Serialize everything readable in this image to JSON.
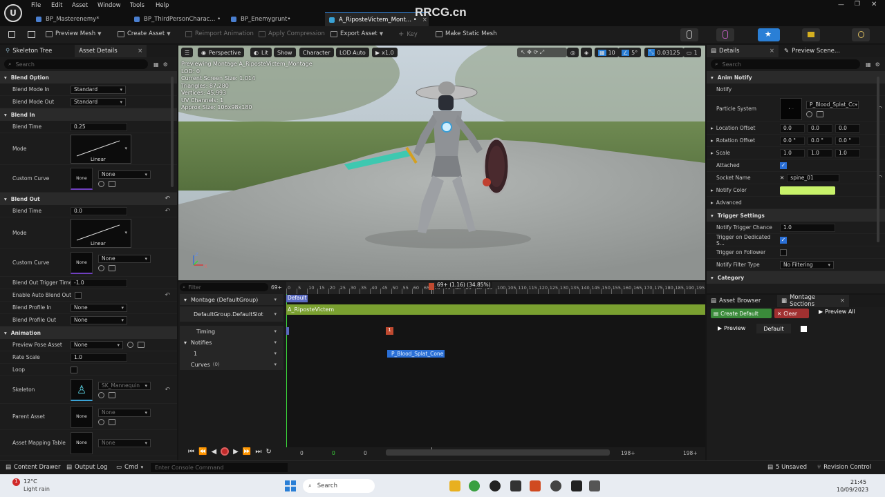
{
  "menu": [
    "File",
    "Edit",
    "Asset",
    "Window",
    "Tools",
    "Help"
  ],
  "doc_tabs": [
    {
      "label": "BP_Masterenemy*"
    },
    {
      "label": "BP_ThirdPersonCharac... •"
    },
    {
      "label": "BP_Enemygrunt•"
    },
    {
      "label": "A_RiposteVictem_Mont... •"
    }
  ],
  "watermark": "RRCG.cn",
  "toolbar": {
    "preview_mesh": "Preview Mesh",
    "create_asset": "Create Asset",
    "reimport": "Reimport Animation",
    "apply_compression": "Apply Compression",
    "export_asset": "Export Asset",
    "key": "Key",
    "make_static_mesh": "Make Static Mesh"
  },
  "left_panel": {
    "tab_skeleton": "Skeleton Tree",
    "tab_asset_details": "Asset Details",
    "search_placeholder": "Search",
    "blend_option": {
      "title": "Blend Option",
      "blend_mode_in_label": "Blend Mode In",
      "blend_mode_in": "Standard",
      "blend_mode_out_label": "Blend Mode Out",
      "blend_mode_out": "Standard"
    },
    "blend_in": {
      "title": "Blend In",
      "blend_time_label": "Blend Time",
      "blend_time": "0.25",
      "mode_label": "Mode",
      "mode": "Linear",
      "custom_curve_label": "Custom Curve",
      "custom_curve": "None",
      "thumb": "None"
    },
    "blend_out": {
      "title": "Blend Out",
      "blend_time_label": "Blend Time",
      "blend_time": "0.0",
      "mode_label": "Mode",
      "mode": "Linear",
      "custom_curve_label": "Custom Curve",
      "custom_curve": "None",
      "thumb": "None",
      "trigger_time_label": "Blend Out Trigger Time",
      "trigger_time": "-1.0",
      "enable_auto_label": "Enable Auto Blend Out",
      "profile_in_label": "Blend Profile In",
      "profile_in": "None",
      "profile_out_label": "Blend Profile Out",
      "profile_out": "None"
    },
    "animation": {
      "title": "Animation",
      "preview_pose_label": "Preview Pose Asset",
      "preview_pose": "None",
      "rate_scale_label": "Rate Scale",
      "rate_scale": "1.0",
      "loop_label": "Loop",
      "skeleton_label": "Skeleton",
      "skeleton": "SK_Mannequin",
      "parent_label": "Parent Asset",
      "parent": "None",
      "parent_thumb": "None",
      "mapping_label": "Asset Mapping Table",
      "mapping": "None",
      "mapping_thumb": "None"
    }
  },
  "viewport": {
    "perspective": "Perspective",
    "lit": "Lit",
    "show": "Show",
    "character": "Character",
    "lod": "LOD Auto",
    "speed": "x1.0",
    "grid": "10",
    "angle": "5°",
    "scale": "0.03125",
    "cam": "1",
    "stats": [
      "Previewing Montage A_RiposteVictem_Montage",
      "LOD: 0",
      "Current Screen Size: 1.014",
      "Triangles: 87,280",
      "Vertices: 45,993",
      "UV Channels: 1",
      "Approx Size: 106x98x180"
    ]
  },
  "sequencer": {
    "filter_placeholder": "Filter",
    "frame_count": "69+",
    "playhead_label": "69+ (1.16) (34.85%)",
    "ticks": [
      "0",
      "5",
      "10",
      "15",
      "20",
      "25",
      "30",
      "35",
      "40",
      "45",
      "50",
      "55",
      "60",
      "65",
      "70",
      "75",
      "80",
      "85",
      "90",
      "95",
      "100",
      "105",
      "110",
      "115",
      "120",
      "125",
      "130",
      "135",
      "140",
      "145",
      "150",
      "155",
      "160",
      "165",
      "170",
      "175",
      "180",
      "185",
      "190",
      "195"
    ],
    "montage_group": "Montage (DefaultGroup)",
    "slot": "DefaultGroup.DefaultSlot",
    "default_section": "Default",
    "anim_segment": "A_RiposteVictem",
    "timing": "Timing",
    "timing_marker": "1",
    "notifies": "Notifies",
    "notify_track": "1",
    "notify_name": "P_Blood_Splat_Cone",
    "curves": "Curves",
    "curves_count": "(0)",
    "start_frame": "0",
    "green_frame": "0",
    "mid_frame": "0",
    "end_frame": "198+",
    "end_frame2": "198+"
  },
  "details": {
    "tab": "Details",
    "tab2": "Preview Scene...",
    "search_placeholder": "Search",
    "anim_notify": "Anim Notify",
    "notify_label": "Notify",
    "particle_label": "Particle System",
    "particle": "P_Blood_Splat_Cc",
    "location_label": "Location Offset",
    "location": [
      "0.0",
      "0.0",
      "0.0"
    ],
    "rotation_label": "Rotation Offset",
    "rotation": [
      "0.0 °",
      "0.0 °",
      "0.0 °"
    ],
    "scale_label": "Scale",
    "scale": [
      "1.0",
      "1.0",
      "1.0"
    ],
    "attached_label": "Attached",
    "socket_label": "Socket Name",
    "socket": "spine_01",
    "color_label": "Notify Color",
    "notify_color": "#c8f26a",
    "advanced": "Advanced",
    "trigger_settings": "Trigger Settings",
    "chance_label": "Notify Trigger Chance",
    "chance": "1.0",
    "dedicated_label": "Trigger on Dedicated S...",
    "follower_label": "Trigger on Follower",
    "filter_label": "Notify Filter Type",
    "filter": "No Filtering",
    "category": "Category"
  },
  "sections_panel": {
    "tab_browser": "Asset Browser",
    "tab_sections": "Montage Sections",
    "create_default": "Create Default",
    "clear": "Clear",
    "preview_all": "Preview All",
    "preview": "Preview",
    "default": "Default"
  },
  "status": {
    "content_drawer": "Content Drawer",
    "output_log": "Output Log",
    "cmd": "Cmd",
    "console_placeholder": "Enter Console Command",
    "unsaved": "5 Unsaved",
    "revision": "Revision Control"
  },
  "taskbar": {
    "temp": "12°C",
    "weather": "Light rain",
    "search": "Search",
    "time": "21:45",
    "date": "10/09/2023"
  }
}
